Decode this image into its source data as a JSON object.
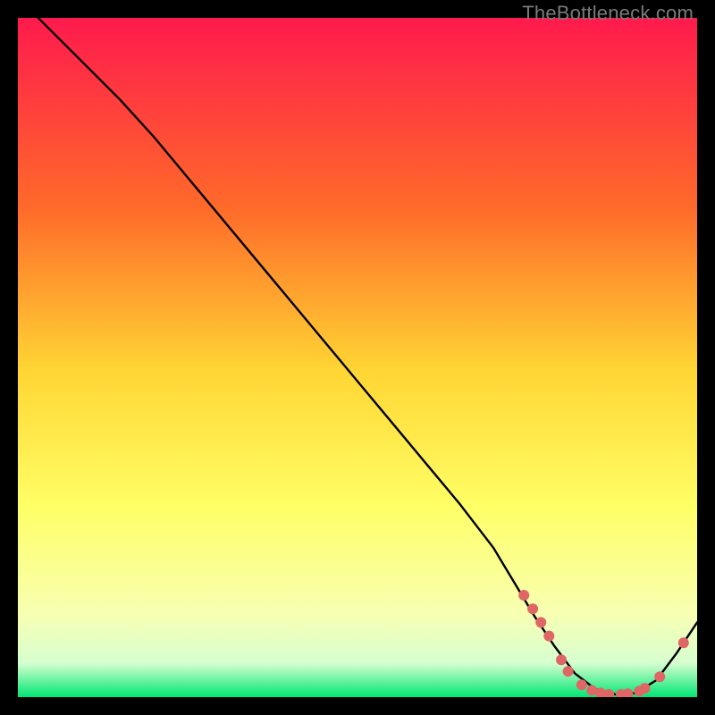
{
  "watermark": "TheBottleneck.com",
  "chart_data": {
    "type": "line",
    "title": "",
    "xlabel": "",
    "ylabel": "",
    "xlim": [
      0,
      100
    ],
    "ylim": [
      0,
      100
    ],
    "background_gradient": {
      "top": "#ff1a4d",
      "upper_mid": "#ff7a2a",
      "mid": "#ffd633",
      "lower_mid": "#ffff66",
      "pale": "#f7ffb3",
      "green": "#00e673"
    },
    "series": [
      {
        "name": "curve",
        "color": "#000000",
        "x": [
          3,
          6,
          10,
          15,
          20,
          25,
          30,
          35,
          40,
          45,
          50,
          55,
          60,
          65,
          70,
          73,
          76,
          79,
          82,
          85,
          88,
          91,
          94,
          97,
          100
        ],
        "y": [
          100,
          97,
          93,
          88,
          82.5,
          76.5,
          70.5,
          64.5,
          58.5,
          52.5,
          46.5,
          40.5,
          34.5,
          28.5,
          22,
          17,
          12,
          7.5,
          3.5,
          1.2,
          0.4,
          0.6,
          2.5,
          6.5,
          11
        ]
      }
    ],
    "markers": {
      "name": "highlight-points",
      "color": "#e06666",
      "radius": 6,
      "points": [
        {
          "x": 74.5,
          "y": 15.0
        },
        {
          "x": 75.8,
          "y": 13.0
        },
        {
          "x": 77.0,
          "y": 11.0
        },
        {
          "x": 78.2,
          "y": 9.0
        },
        {
          "x": 80.0,
          "y": 5.5
        },
        {
          "x": 81.0,
          "y": 3.8
        },
        {
          "x": 83.0,
          "y": 1.8
        },
        {
          "x": 84.5,
          "y": 1.0
        },
        {
          "x": 85.8,
          "y": 0.6
        },
        {
          "x": 87.0,
          "y": 0.4
        },
        {
          "x": 88.8,
          "y": 0.4
        },
        {
          "x": 89.8,
          "y": 0.5
        },
        {
          "x": 91.5,
          "y": 0.9
        },
        {
          "x": 92.3,
          "y": 1.3
        },
        {
          "x": 94.5,
          "y": 3.0
        },
        {
          "x": 98.0,
          "y": 8.0
        }
      ]
    }
  }
}
